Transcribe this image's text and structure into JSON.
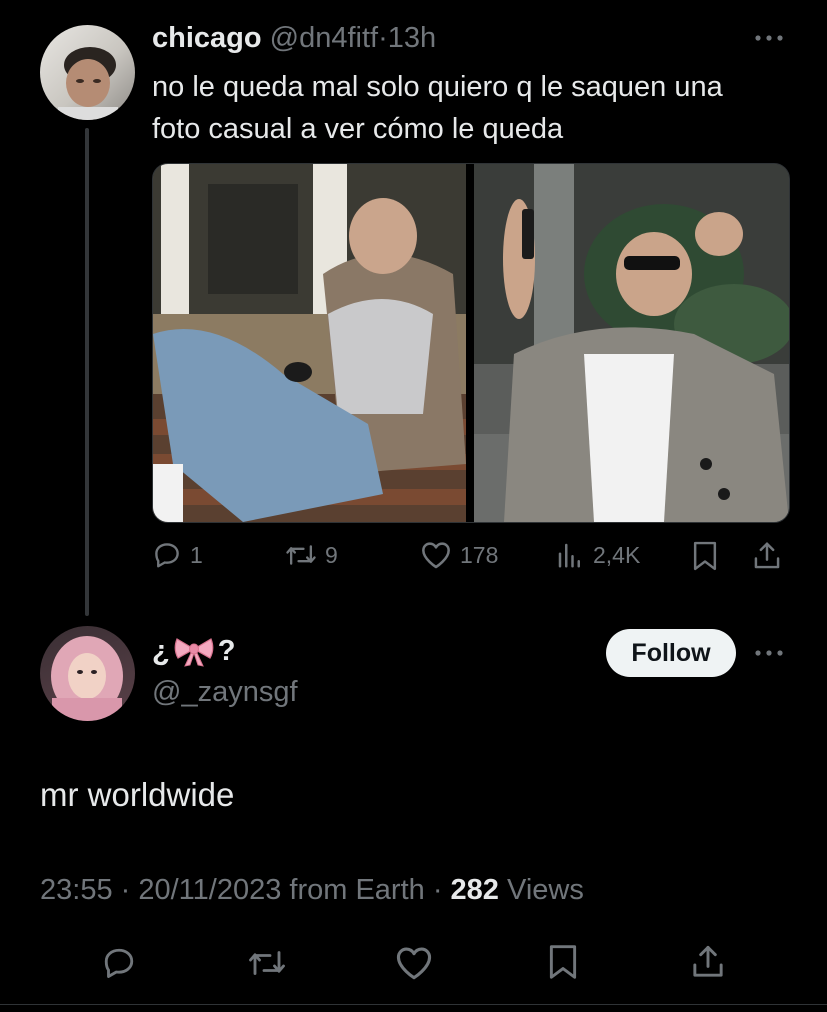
{
  "reply_tweet": {
    "display_name": "chicago",
    "handle": "@dn4fitf",
    "separator": "·",
    "time": "13h",
    "text_line1": "no le queda mal solo quiero q le saquen una",
    "text_line2": "foto casual a ver cómo le queda",
    "more_label": "···",
    "stats": {
      "replies": "1",
      "retweets": "9",
      "likes": "178",
      "views": "2,4K"
    }
  },
  "main_tweet": {
    "display_name_prefix": "¿",
    "display_name_suffix": "?",
    "handle": "@_zaynsgf",
    "follow_label": "Follow",
    "more_label": "···",
    "text": "mr worldwide",
    "timestamp": "23:55 · 20/11/2023 from Earth ·",
    "views_count": "282",
    "views_label": "Views"
  },
  "colors": {
    "background": "#000000",
    "text_primary": "#e7e9ea",
    "text_muted": "#71767b",
    "follow_bg": "#eff3f4",
    "follow_text": "#0f1419"
  }
}
